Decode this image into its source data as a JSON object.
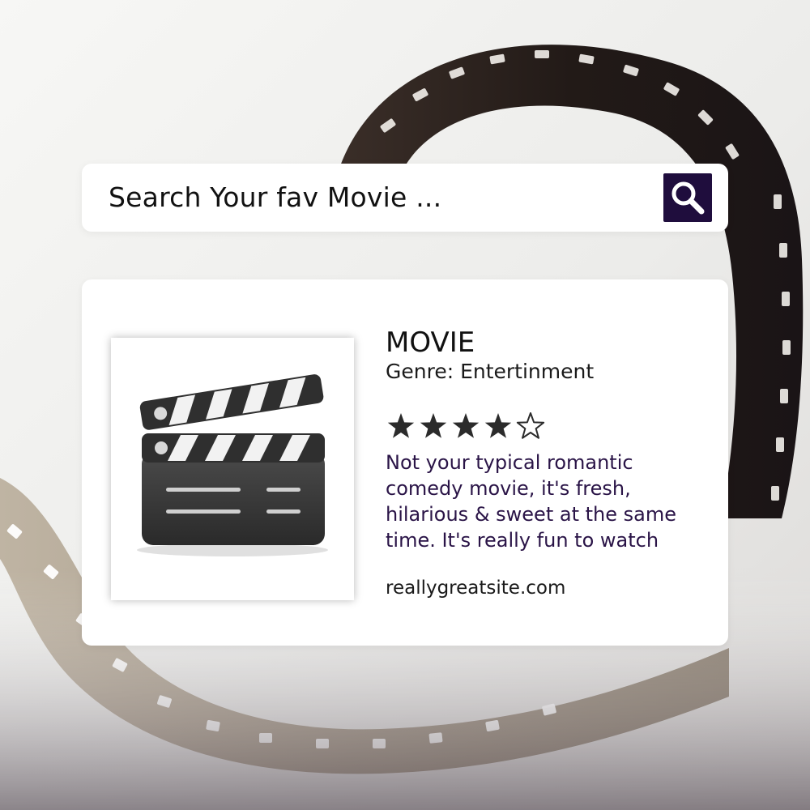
{
  "search": {
    "placeholder": "Search Your fav Movie ..."
  },
  "search_button": {
    "icon": "magnifier-icon",
    "color": "#1f0d3d"
  },
  "movie": {
    "title": "MOVIE",
    "genre": "Genre: Entertinment",
    "rating": 4,
    "rating_max": 5,
    "review": "Not your typical romantic comedy movie, it's fresh, hilarious & sweet at the same time. It's really fun to watch",
    "website": "reallygreatsite.com",
    "poster_icon": "clapperboard-icon"
  },
  "colors": {
    "accent": "#1f0d3d",
    "review_text": "#2a1447",
    "card": "#ffffff",
    "star": "#2b2b2b"
  }
}
